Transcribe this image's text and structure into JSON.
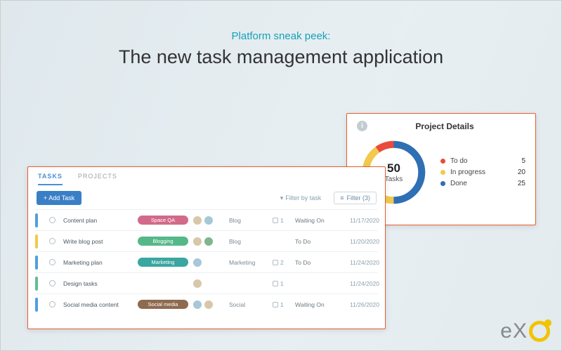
{
  "hero": {
    "kicker": "Platform sneak peek:",
    "title": "The new task management application"
  },
  "tasks_panel": {
    "tabs": {
      "tasks": "TASKS",
      "projects": "PROJECTS"
    },
    "add_button": "+ Add Task",
    "filter_by_task": "Filter by task",
    "filter_button": "Filter (3)",
    "rows": [
      {
        "name": "Content plan",
        "tag": "Space QA",
        "category": "Blog",
        "count": "1",
        "status": "Waiting On",
        "date": "11/17/2020"
      },
      {
        "name": "Write blog post",
        "tag": "Blogging",
        "category": "Blog",
        "count": "",
        "status": "To Do",
        "date": "11/20/2020"
      },
      {
        "name": "Marketing plan",
        "tag": "Marketing",
        "category": "Marketing",
        "count": "2",
        "status": "To Do",
        "date": "11/24/2020"
      },
      {
        "name": "Design tasks",
        "tag": "",
        "category": "",
        "count": "1",
        "status": "",
        "date": "11/24/2020"
      },
      {
        "name": "Social media content",
        "tag": "Social media",
        "category": "Social",
        "count": "1",
        "status": "Waiting On",
        "date": "11/26/2020"
      }
    ]
  },
  "details": {
    "title": "Project Details",
    "total_value": "50",
    "total_label": "Tasks",
    "legend": [
      {
        "name": "To do",
        "value": "5",
        "color": "#e74c3c"
      },
      {
        "name": "In progress",
        "value": "20",
        "color": "#f2c94c"
      },
      {
        "name": "Done",
        "value": "25",
        "color": "#2f6fb3"
      }
    ]
  },
  "chart_data": {
    "type": "pie",
    "title": "Project Details",
    "series": [
      {
        "name": "To do",
        "value": 5,
        "color": "#e74c3c"
      },
      {
        "name": "In progress",
        "value": 20,
        "color": "#f2c94c"
      },
      {
        "name": "Done",
        "value": 25,
        "color": "#2f6fb3"
      }
    ],
    "total": 50,
    "total_label": "Tasks"
  },
  "brand": {
    "name": "eXo"
  }
}
